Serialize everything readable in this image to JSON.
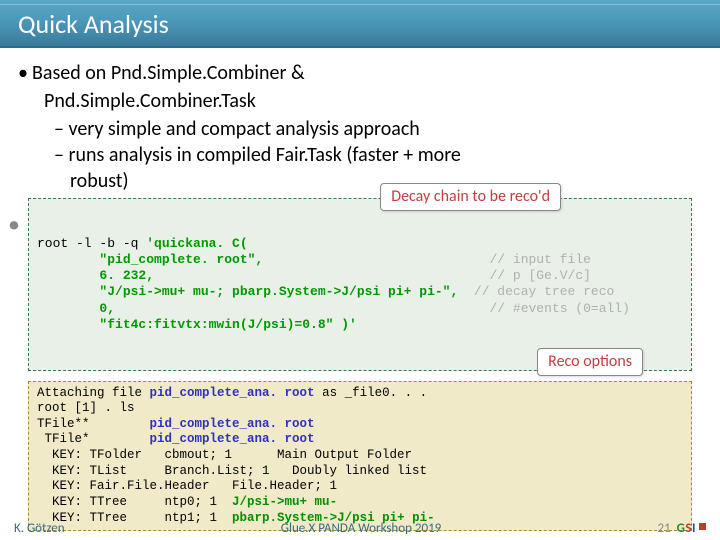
{
  "title": "Quick Analysis",
  "bullets": {
    "b1a": "Based on  Pnd.Simple.Combiner    &",
    "b1b": "Pnd.Simple.Combiner.Task",
    "s1": "very simple and compact analysis approach",
    "s2": "runs analysis in compiled Fair.Task (faster + more",
    "s2c": "robust)"
  },
  "callout": {
    "decay": "Decay chain to be reco'd",
    "reco": "Reco options"
  },
  "code1": {
    "l1a": "root -l -b -q ",
    "l1b": "'quickana. C(",
    "l2": "        \"pid_complete. root\",",
    "l3": "        6. 232,",
    "l4": "        \"J/psi->mu+ mu-; pbarp.System->J/psi pi+ pi-\",",
    "l5": "        0,",
    "l6": "        \"fit4c:fitvtx:mwin(J/psi)=0.8\" )'",
    "c2": "// input file",
    "c3": "// p [Ge.V/c]",
    "c4": "// decay tree reco",
    "c5": "// #events (0=all)"
  },
  "code2": {
    "l1a": "Attaching file ",
    "l1b": "pid_complete_ana. root",
    "l1c": " as _file0. . .",
    "l2": "root [1] . ls",
    "l3a": "TFile**        ",
    "l3b": "pid_complete_ana. root",
    "l4a": " TFile*        ",
    "l4b": "pid_complete_ana. root",
    "l5": "  KEY: TFolder   cbmout; 1      Main Output Folder",
    "l6": "  KEY: TList     Branch.List; 1   Doubly linked list",
    "l7": "  KEY: Fair.File.Header   File.Header; 1",
    "l8a": "  KEY: TTree     ntp0; 1  ",
    "l8b": "J/psi->mu+ mu-",
    "l9a": "  KEY: TTree     ntp1; 1  ",
    "l9b": "pbarp.System->J/psi pi+ pi-"
  },
  "footer": {
    "author": "K. Götzen",
    "venue": "Glue.X PANDA Workshop 2019",
    "page": "21"
  }
}
